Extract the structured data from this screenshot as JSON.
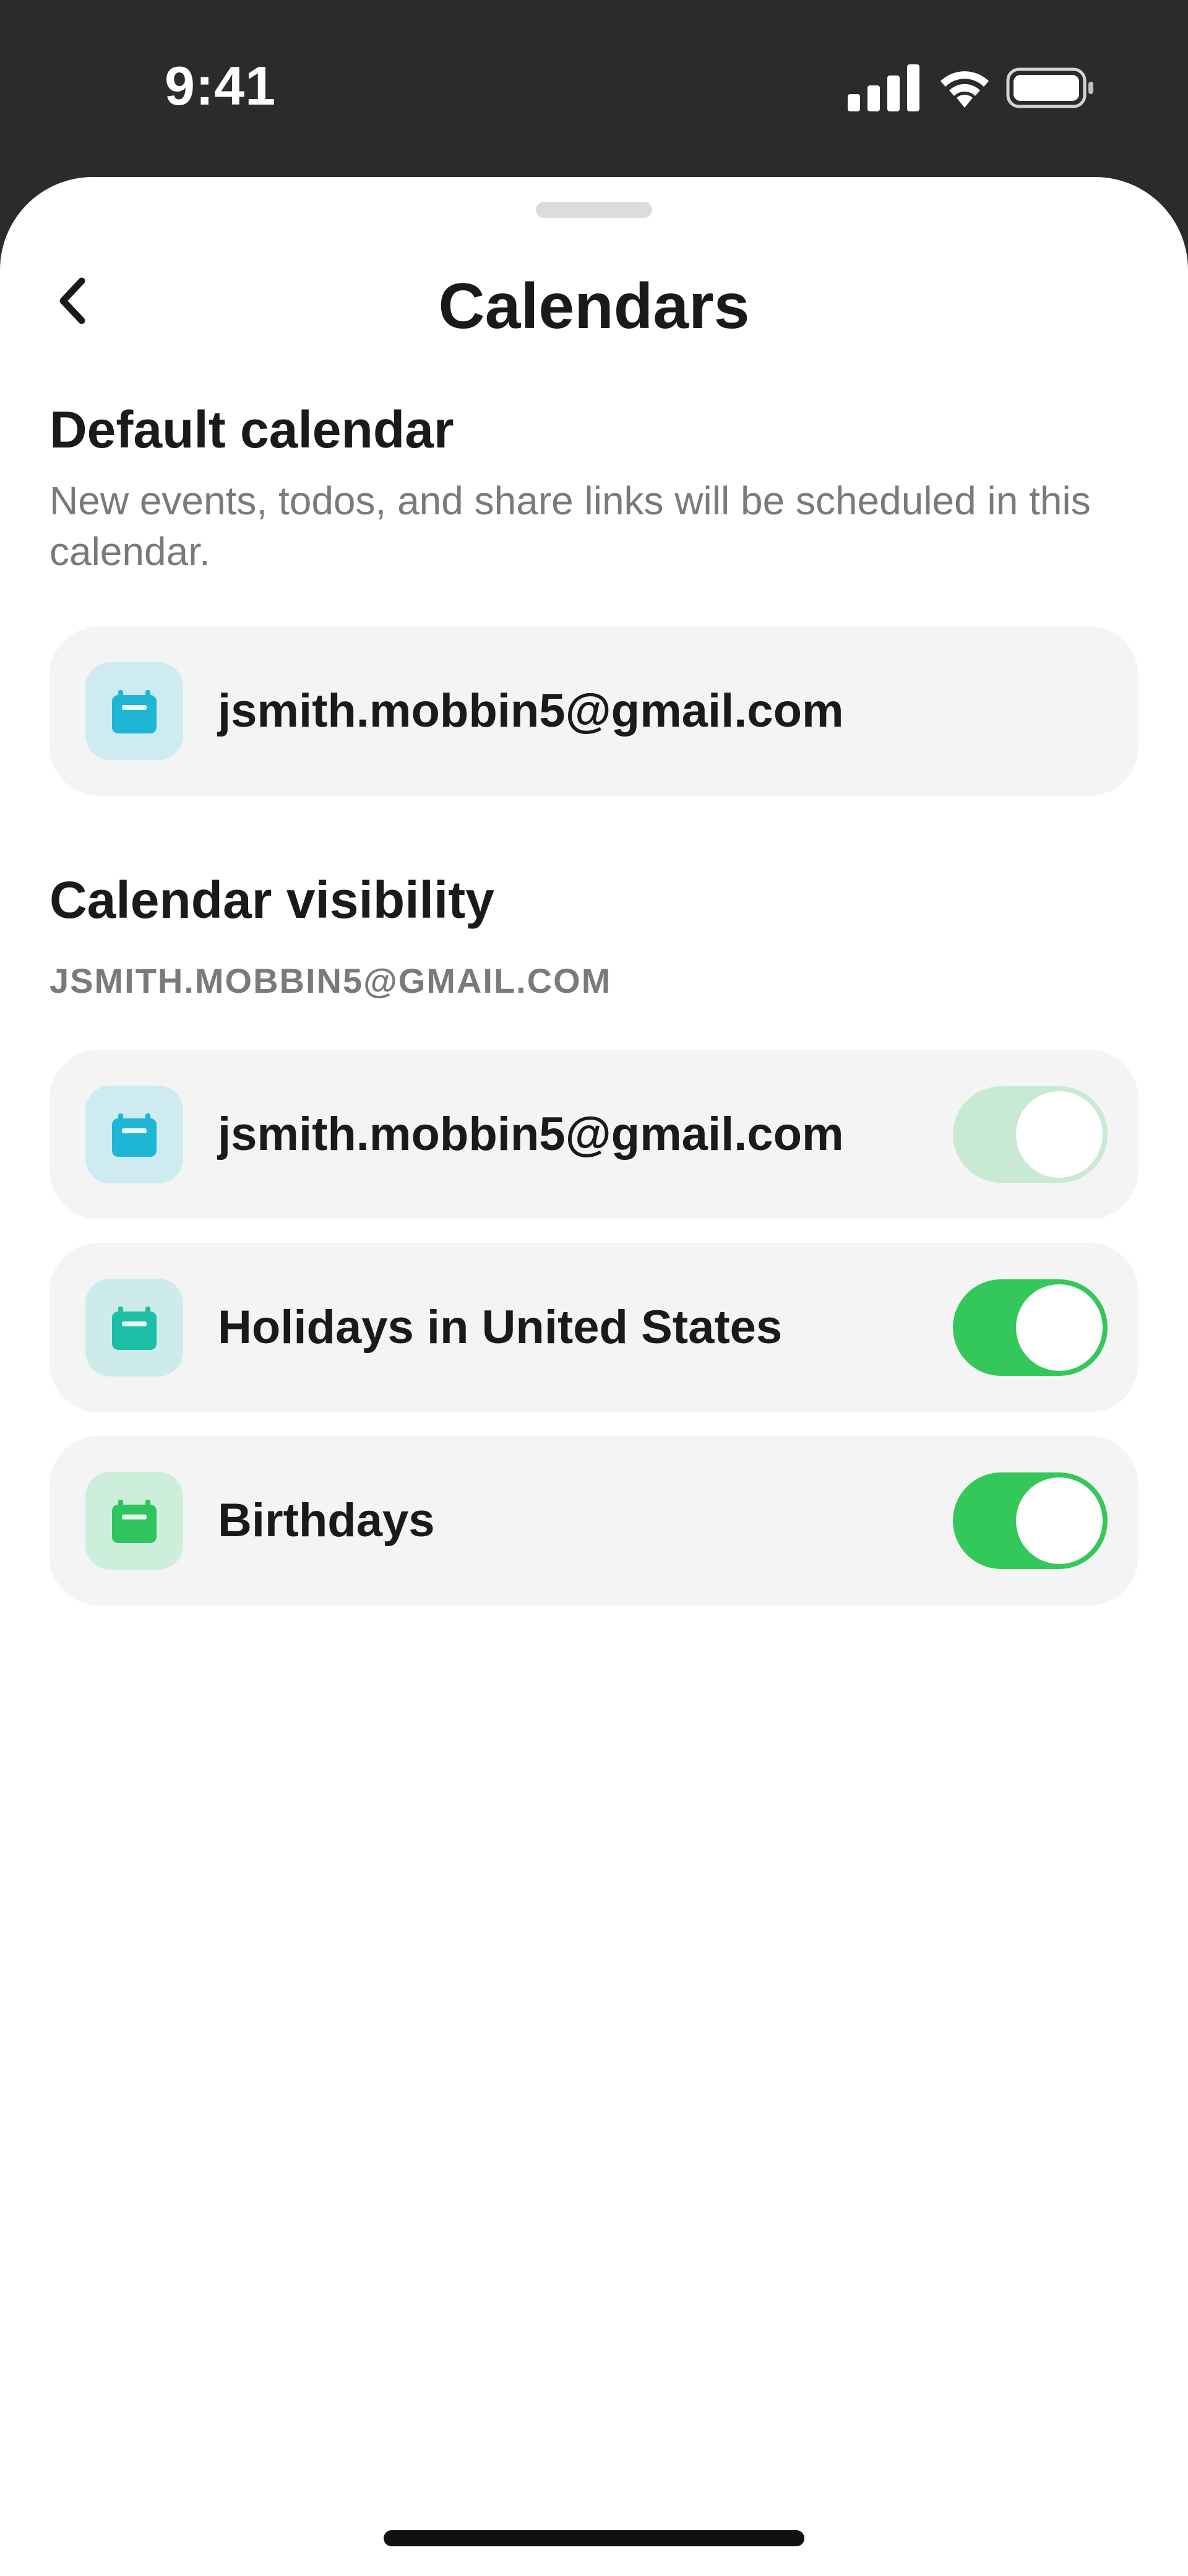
{
  "status_bar": {
    "time": "9:41",
    "icons": [
      "signal-icon",
      "wifi-icon",
      "battery-icon"
    ]
  },
  "header": {
    "title": "Calendars",
    "back_icon": "chevron-left-icon"
  },
  "default_calendar": {
    "heading": "Default calendar",
    "description": "New events, todos, and share links will be scheduled in this calendar.",
    "selected": {
      "label": "jsmith.mobbin5@gmail.com",
      "icon": "calendar-icon",
      "icon_color": "#1fb6d6",
      "icon_bg": "#cdebf0"
    }
  },
  "calendar_visibility": {
    "heading": "Calendar visibility",
    "account": "JSMITH.MOBBIN5@GMAIL.COM",
    "items": [
      {
        "label": "jsmith.mobbin5@gmail.com",
        "icon": "calendar-icon",
        "icon_color": "#1fb6d6",
        "icon_bg": "#cdebf0",
        "enabled": true,
        "disabled_control": true
      },
      {
        "label": "Holidays in United States",
        "icon": "calendar-icon",
        "icon_color": "#1cbfa6",
        "icon_bg": "#cdebea",
        "enabled": true,
        "disabled_control": false
      },
      {
        "label": "Birthdays",
        "icon": "calendar-icon",
        "icon_color": "#2fc45e",
        "icon_bg": "#cdeedb",
        "enabled": true,
        "disabled_control": false
      }
    ]
  },
  "colors": {
    "toggle_on": "#34c759",
    "toggle_dim": "#c8ead2",
    "card_bg": "#f4f4f4"
  }
}
